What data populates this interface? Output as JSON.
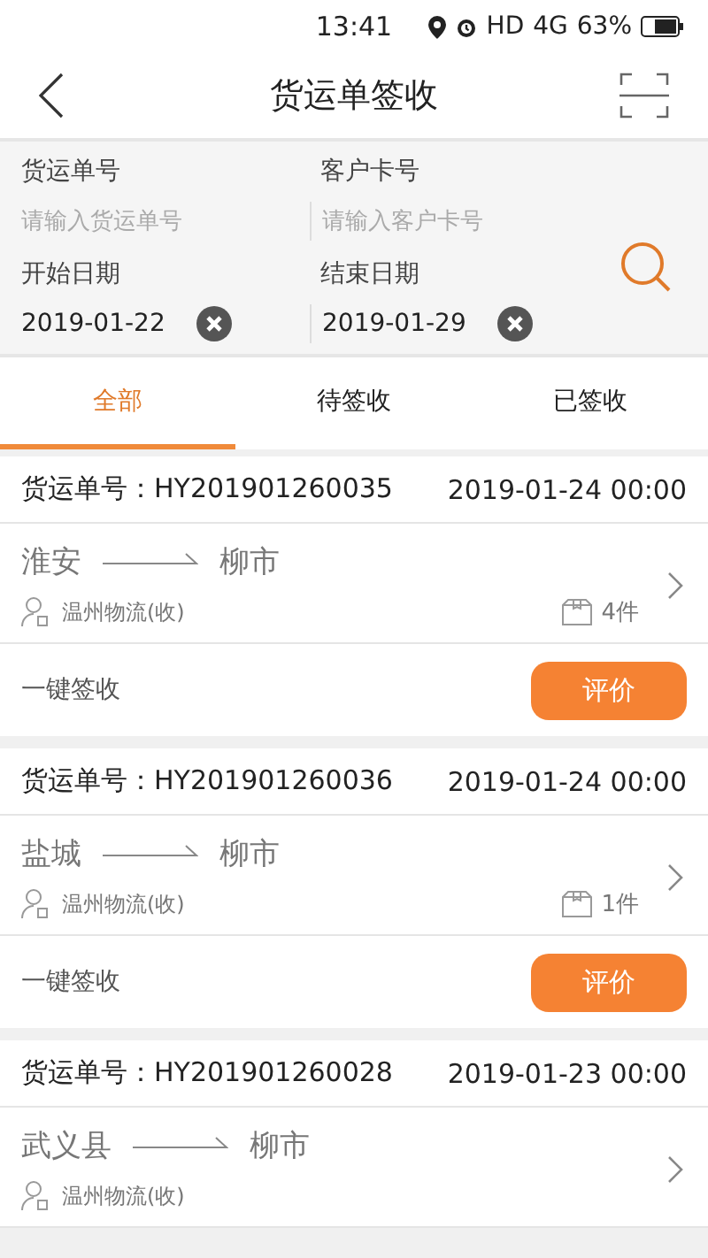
{
  "status_bar": {
    "time": "13:41",
    "network": "HD",
    "signal": "4G",
    "battery": "63%"
  },
  "nav": {
    "title": "货运单签收"
  },
  "filters": [
    {
      "label": "货运单号",
      "placeholder": "请输入货运单号"
    },
    {
      "label": "客户卡号",
      "placeholder": "请输入客户卡号"
    },
    {
      "label": "开始日期",
      "value": "2019-01-22"
    },
    {
      "label": "结束日期",
      "value": "2019-01-29"
    }
  ],
  "tabs": [
    {
      "label": "全部",
      "selected": true
    },
    {
      "label": "待签收",
      "selected": false
    },
    {
      "label": "已签收",
      "selected": false
    }
  ],
  "orders": [
    {
      "number": "货运单号：HY201901260035",
      "time": "2019-01-24 00:00",
      "from": "淮安",
      "to": "柳市",
      "company": "温州物流(收)",
      "count": "4件",
      "action": "一键签收",
      "button": "评价"
    },
    {
      "number": "货运单号：HY201901260036",
      "time": "2019-01-24 00:00",
      "from": "盐城",
      "to": "柳市",
      "company": "温州物流(收)",
      "count": "1件",
      "action": "一键签收",
      "button": "评价"
    },
    {
      "number": "货运单号：HY201901260028",
      "time": "2019-01-23 00:00",
      "from": "武义县",
      "to": "柳市",
      "company": "温州物流(收)"
    }
  ]
}
